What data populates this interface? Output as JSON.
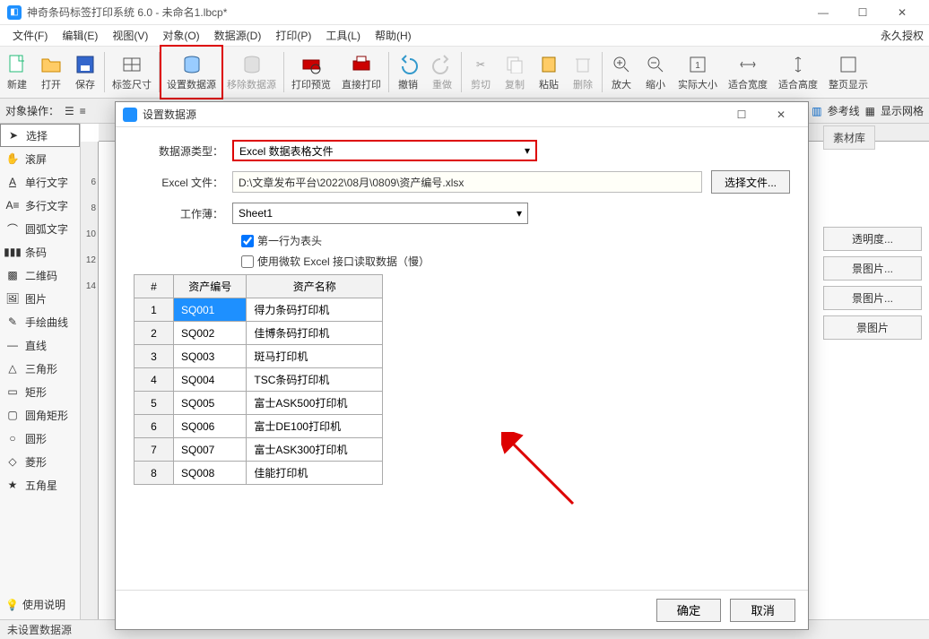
{
  "app": {
    "title": "神奇条码标签打印系统 6.0 - 未命名1.lbcp*",
    "license": "永久授权"
  },
  "menu": {
    "file": "文件(F)",
    "edit": "编辑(E)",
    "view": "视图(V)",
    "object": "对象(O)",
    "datasource": "数据源(D)",
    "print": "打印(P)",
    "tools": "工具(L)",
    "help": "帮助(H)"
  },
  "toolbar": {
    "new": "新建",
    "open": "打开",
    "save": "保存",
    "labelsize": "标签尺寸",
    "setds": "设置数据源",
    "removeds": "移除数据源",
    "preview": "打印预览",
    "directprint": "直接打印",
    "undo": "撤销",
    "redo": "重做",
    "cut": "剪切",
    "copy": "复制",
    "paste": "粘贴",
    "delete": "删除",
    "zoomin": "放大",
    "zoomout": "缩小",
    "actual": "实际大小",
    "fitw": "适合宽度",
    "fith": "适合高度",
    "fitpage": "整页显示"
  },
  "secbar": {
    "objops": "对象操作：",
    "guides": "参考线",
    "grid": "显示网格"
  },
  "tools": {
    "select": "选择",
    "scroll": "滚屏",
    "text1": "单行文字",
    "text2": "多行文字",
    "arctext": "圆弧文字",
    "barcode": "条码",
    "qrcode": "二维码",
    "image": "图片",
    "freehand": "手绘曲线",
    "line": "直线",
    "triangle": "三角形",
    "rect": "矩形",
    "roundrect": "圆角矩形",
    "circle": "圆形",
    "diamond": "菱形",
    "star": "五角星",
    "help": "使用说明"
  },
  "right": {
    "tab": "素材库",
    "transparency": "透明度...",
    "bgimg1": "景图片...",
    "bgimg2": "景图片...",
    "bgimg3": "景图片"
  },
  "status": {
    "ds": "未设置数据源"
  },
  "dialog": {
    "title": "设置数据源",
    "labels": {
      "type": "数据源类型：",
      "file": "Excel 文件：",
      "sheet": "工作薄："
    },
    "type_value": "Excel 数据表格文件",
    "file_value": "D:\\文章发布平台\\2022\\08月\\0809\\资产编号.xlsx",
    "sheet_value": "Sheet1",
    "browse": "选择文件...",
    "chk1": "第一行为表头",
    "chk2": "使用微软 Excel 接口读取数据（慢）",
    "col_num": "#",
    "col_a": "资产编号",
    "col_b": "资产名称",
    "rows": [
      {
        "n": "1",
        "a": "SQ001",
        "b": "得力条码打印机"
      },
      {
        "n": "2",
        "a": "SQ002",
        "b": "佳博条码打印机"
      },
      {
        "n": "3",
        "a": "SQ003",
        "b": "斑马打印机"
      },
      {
        "n": "4",
        "a": "SQ004",
        "b": "TSC条码打印机"
      },
      {
        "n": "5",
        "a": "SQ005",
        "b": "富士ASK500打印机"
      },
      {
        "n": "6",
        "a": "SQ006",
        "b": "富士DE100打印机"
      },
      {
        "n": "7",
        "a": "SQ007",
        "b": "富士ASK300打印机"
      },
      {
        "n": "8",
        "a": "SQ008",
        "b": "佳能打印机"
      }
    ],
    "ok": "确定",
    "cancel": "取消"
  }
}
